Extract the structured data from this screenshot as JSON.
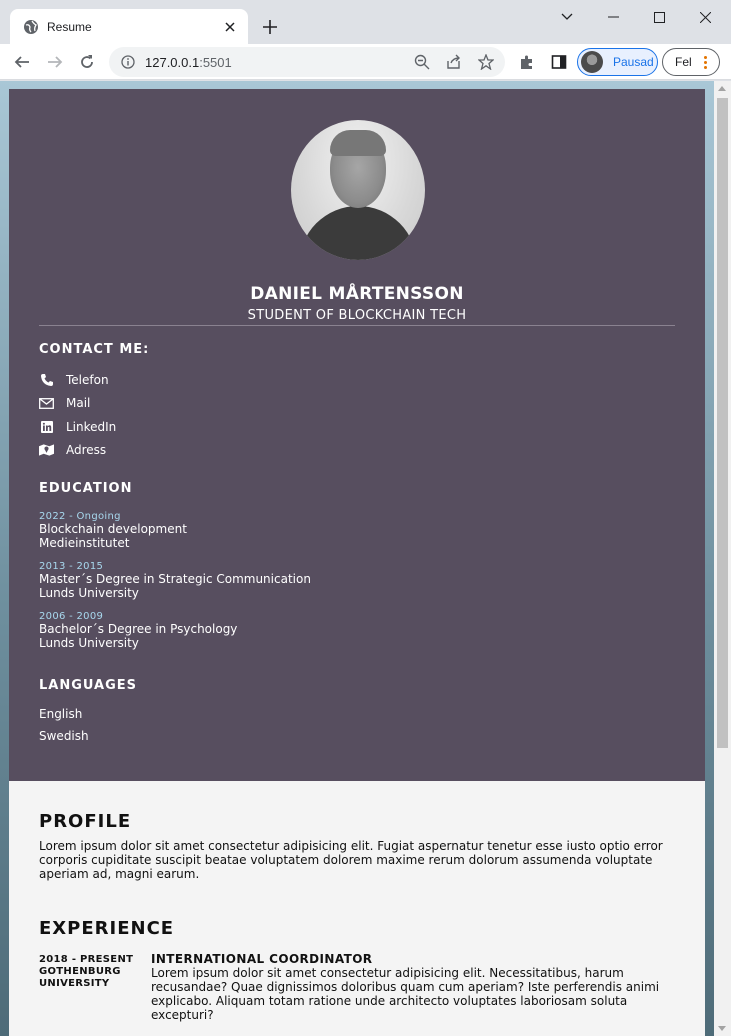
{
  "browser": {
    "tab_title": "Resume",
    "url_host": "127.0.0.1",
    "url_port": ":5501",
    "profile_label": "Pausad",
    "error_label": "Fel"
  },
  "header": {
    "name": "DANIEL MÅRTENSSON",
    "title": "STUDENT OF BLOCKCHAIN TECH"
  },
  "contact": {
    "heading": "CONTACT ME:",
    "items": [
      {
        "icon": "phone-icon",
        "label": "Telefon"
      },
      {
        "icon": "mail-icon",
        "label": "Mail"
      },
      {
        "icon": "linkedin-icon",
        "label": "LinkedIn"
      },
      {
        "icon": "map-icon",
        "label": "Adress"
      }
    ]
  },
  "education": {
    "heading": "EDUCATION",
    "items": [
      {
        "date": "2022 - Ongoing",
        "degree": "Blockchain development",
        "school": "Medieinstitutet"
      },
      {
        "date": "2013 - 2015",
        "degree": "Master´s Degree in Strategic Communication",
        "school": "Lunds University"
      },
      {
        "date": "2006 - 2009",
        "degree": "Bachelor´s Degree in Psychology",
        "school": "Lunds University"
      }
    ]
  },
  "languages": {
    "heading": "LANGUAGES",
    "items": [
      "English",
      "Swedish"
    ]
  },
  "profile": {
    "heading": "PROFILE",
    "text": "Lorem ipsum dolor sit amet consectetur adipisicing elit. Fugiat aspernatur tenetur esse iusto optio error corporis cupiditate suscipit beatae voluptatem dolorem maxime rerum dolorum assumenda voluptate aperiam ad, magni earum."
  },
  "experience": {
    "heading": "EXPERIENCE",
    "items": [
      {
        "date": "2018 - PRESENT",
        "org": "GOTHENBURG UNIVERSITY",
        "title": "INTERNATIONAL COORDINATOR",
        "text": "Lorem ipsum dolor sit amet consectetur adipisicing elit. Necessitatibus, harum recusandae? Quae dignissimos doloribus quam cum aperiam? Iste perferendis animi explicabo. Aliquam totam ratione unde architecto voluptates laboriosam soluta excepturi?"
      }
    ]
  }
}
